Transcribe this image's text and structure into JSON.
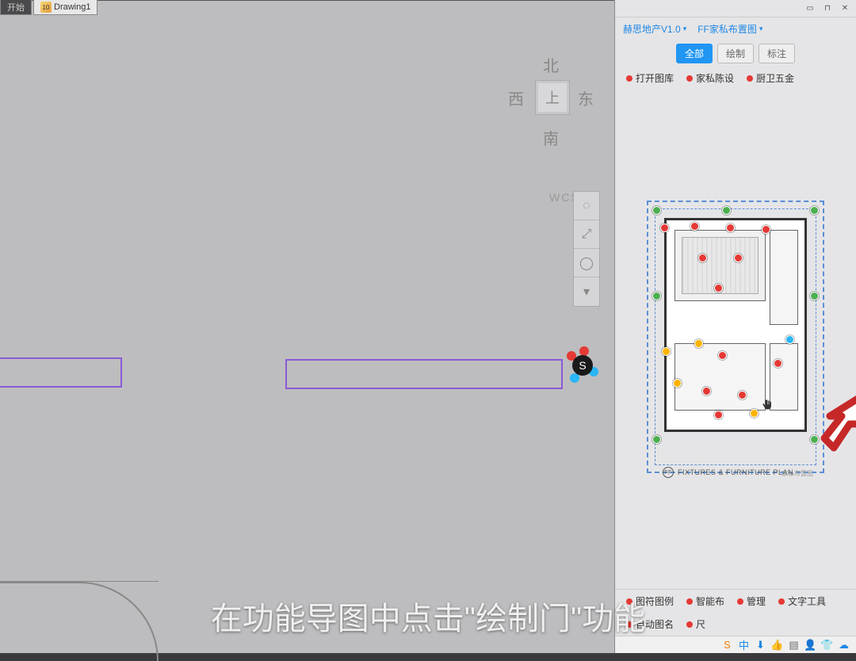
{
  "tabs": {
    "start": "开始",
    "drawing": "Drawing1"
  },
  "viewcube": {
    "north": "北",
    "south": "南",
    "east": "东",
    "west": "西",
    "top": "上",
    "wcs": "WCS"
  },
  "panel": {
    "breadcrumb1": "赫思地产V1.0",
    "breadcrumb2": "FF家私布置图",
    "filters": {
      "all": "全部",
      "draw": "绘制",
      "annotate": "标注"
    },
    "categories": {
      "c1": "打开图库",
      "c2": "家私陈设",
      "c3": "厨卫五金"
    },
    "caption": "FIXTURES & FURNITURE PLAN",
    "caption_sub": "家私布置图",
    "bottom": {
      "b1": "图符图例",
      "b2": "智能布",
      "b3": "管理",
      "b4": "文字工具",
      "b5": "自动图名",
      "b6": "尺"
    }
  },
  "overlay_caption": "在功能导图中点击\"绘制门\"功能",
  "colors": {
    "accent": "#2196f3",
    "link": "#1e88e5",
    "red": "#e53935"
  }
}
